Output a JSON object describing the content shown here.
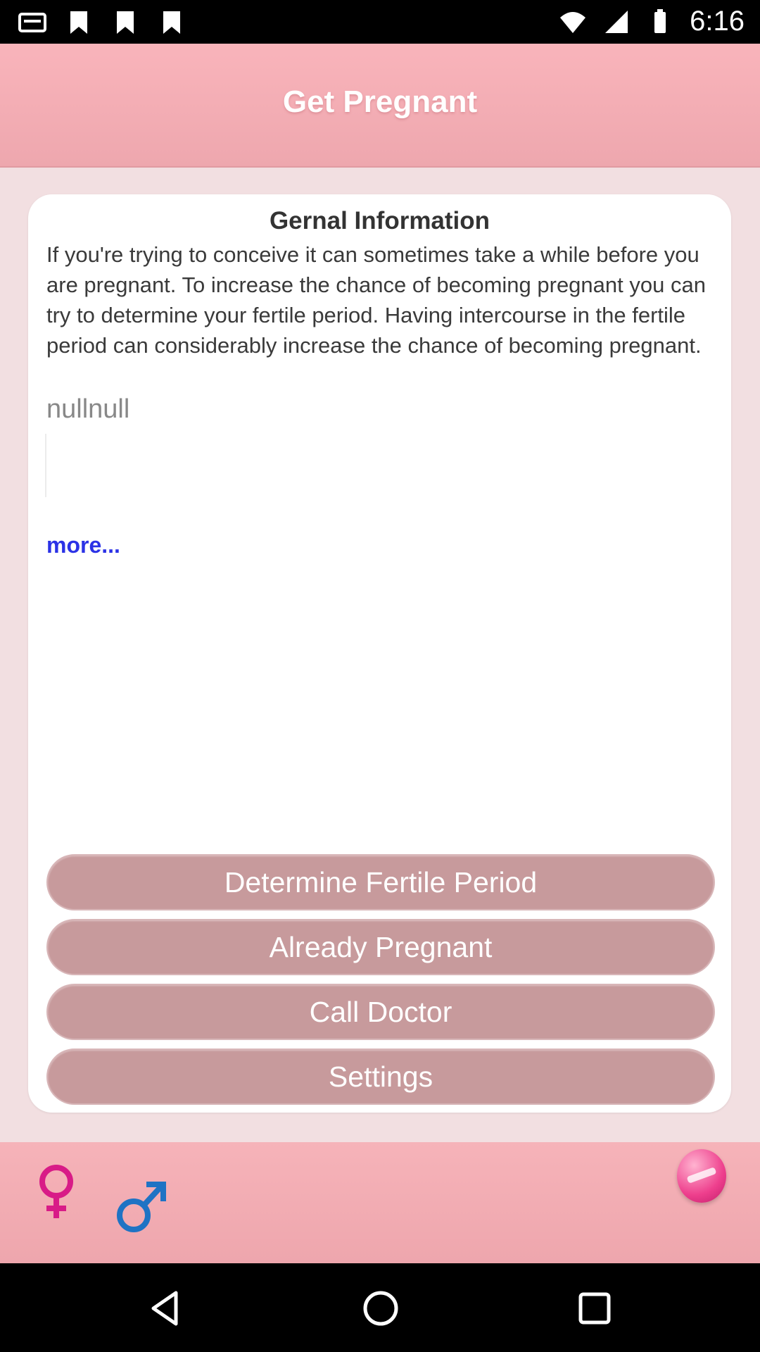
{
  "status_bar": {
    "time": "6:16"
  },
  "header": {
    "title": "Get Pregnant"
  },
  "card": {
    "title": "Gernal Information",
    "body": "If you're trying to conceive it can sometimes take a while before you are pregnant. To increase the chance of becoming pregnant you can try to determine your fertile period. Having intercourse in the fertile period can considerably increase the chance of becoming pregnant.",
    "extra": "nullnull",
    "more_link": "more..."
  },
  "buttons": {
    "fertile": "Determine Fertile Period",
    "pregnant": "Already Pregnant",
    "doctor": "Call Doctor",
    "settings": "Settings"
  },
  "bottom_bar": {
    "icons": [
      "female-symbol-icon",
      "male-symbol-icon",
      "pregnancy-test-icon"
    ]
  },
  "colors": {
    "header": "#f6adb4",
    "button": "#c79a9c",
    "link": "#2b32e6",
    "female": "#d81b87",
    "male": "#1f73c4"
  }
}
